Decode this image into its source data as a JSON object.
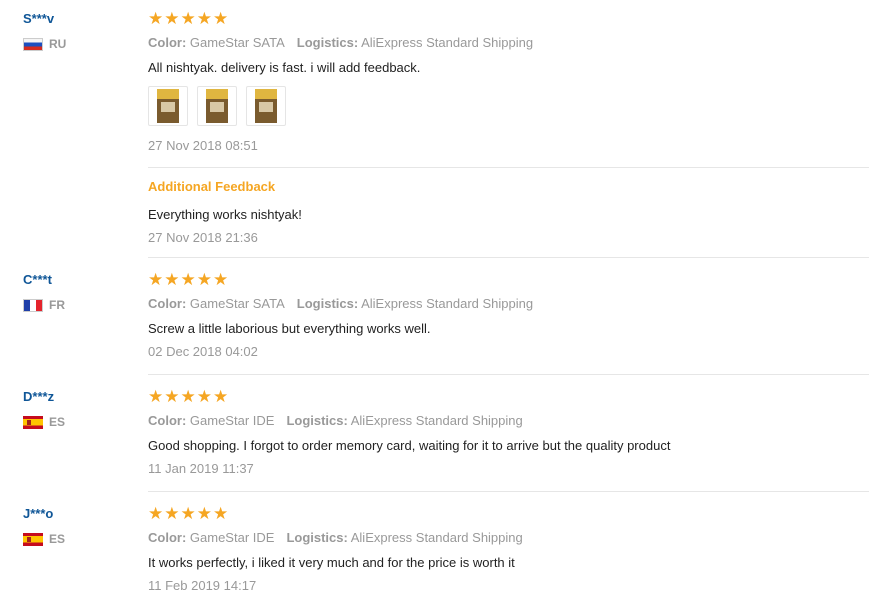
{
  "labels": {
    "color": "Color:",
    "logistics": "Logistics:",
    "additional_feedback": "Additional Feedback"
  },
  "reviews": [
    {
      "user": "S***v",
      "country": "RU",
      "stars": 5,
      "color": "GameStar SATA",
      "logistics": "AliExpress Standard Shipping",
      "text": "All nishtyak. delivery is fast. i will add feedback.",
      "date": "27 Nov 2018 08:51",
      "additional_text": "Everything works nishtyak!",
      "additional_date": "27 Nov 2018 21:36"
    },
    {
      "user": "C***t",
      "country": "FR",
      "stars": 5,
      "color": "GameStar SATA",
      "logistics": "AliExpress Standard Shipping",
      "text": "Screw a little laborious but everything works well.",
      "date": "02 Dec 2018 04:02"
    },
    {
      "user": "D***z",
      "country": "ES",
      "stars": 5,
      "color": "GameStar IDE",
      "logistics": "AliExpress Standard Shipping",
      "text": "Good shopping. I forgot to order memory card, waiting for it to arrive but the quality product",
      "date": "11 Jan 2019 11:37"
    },
    {
      "user": "J***o",
      "country": "ES",
      "stars": 5,
      "color": "GameStar IDE",
      "logistics": "AliExpress Standard Shipping",
      "text": "It works perfectly, i liked it very much and for the price is worth it",
      "date": "11 Feb 2019 14:17"
    }
  ],
  "colors": {
    "star": "#f5a623",
    "username": "#0f5697",
    "muted": "#999999",
    "accent": "#f5a623"
  }
}
